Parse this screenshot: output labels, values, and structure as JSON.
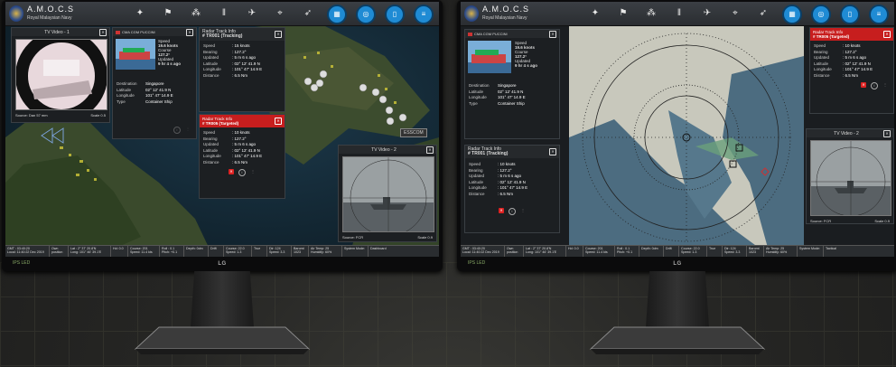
{
  "app": {
    "title": "A.M.O.C.S",
    "subtitle": "Royal Malaysian Navy"
  },
  "toolbar_icons": [
    "compass-icon",
    "flag-icon",
    "network-icon",
    "weapon-icon",
    "plane-icon",
    "map-pin-icon",
    "jet-icon",
    "monitor-icon"
  ],
  "right_buttons": [
    "grid-icon",
    "target-icon",
    "map-icon",
    "layers-icon"
  ],
  "left": {
    "tv1": {
      "title": "TV Video - 1",
      "source": "Source: Dan 57 mm",
      "scale": "Scale 0.5"
    },
    "ship": {
      "name": "CMA CGM PUCCINI",
      "speed_label": "Speed",
      "speed": "19.6 knots",
      "course_label": "Course",
      "course": "127.2°",
      "updated_label": "Updated",
      "updated": "9 hr 4 s ago",
      "rows": [
        [
          "Destination",
          "Singapore"
        ],
        [
          "Latitude",
          "02° 12' 41.9 N"
        ],
        [
          "Longitude",
          "101° 47' 14.9 E"
        ],
        [
          "Type",
          "Container Ship"
        ]
      ]
    },
    "track1": {
      "title": "Radar Track Info",
      "id": "# TR001 (Tracking)",
      "rows": [
        [
          "Speed",
          ": 15 knots"
        ],
        [
          "Bearing",
          ": 127.2°"
        ],
        [
          "Updated",
          ": 5 m 6 s ago"
        ],
        [
          "Latitude",
          ": 02° 12' 41.9 N"
        ],
        [
          "Longitude",
          ": 101° 47' 14.9 E"
        ],
        [
          "Distance",
          ": 6.5 Nm"
        ]
      ]
    },
    "track2": {
      "title": "Radar Track Info",
      "id": "# TR005 (Targeted)",
      "rows": [
        [
          "Speed",
          ": 10 knots"
        ],
        [
          "Bearing",
          ": 127.2°"
        ],
        [
          "Updated",
          ": 5 m 6 s ago"
        ],
        [
          "Latitude",
          ": 02° 12' 41.9 N"
        ],
        [
          "Longitude",
          ": 101° 47' 14.9 E"
        ],
        [
          "Distance",
          ": 6.5 Nm"
        ]
      ]
    },
    "tv2": {
      "title": "TV Video - 2",
      "source": "Source: FCR",
      "scale": "Scale 0.9"
    },
    "escom": "ESSCOM",
    "dashboard": "Dashboard"
  },
  "right": {
    "ship": {
      "name": "CMA CGM PUCCINI",
      "speed_label": "Speed",
      "speed": "19.6 knots",
      "course_label": "Course",
      "course": "127.2°",
      "updated_label": "Updated",
      "updated": "9 hr 4 s ago",
      "rows": [
        [
          "Destination",
          "Singapore"
        ],
        [
          "Latitude",
          "02° 12' 41.9 N"
        ],
        [
          "Longitude",
          "101° 47' 14.9 E"
        ],
        [
          "Type",
          "Container Ship"
        ]
      ]
    },
    "track1": {
      "title": "Radar Track Info",
      "id": "# TR001 (Tracking)",
      "rows": [
        [
          "Speed",
          ": 10 knots"
        ],
        [
          "Bearing",
          ": 127.2°"
        ],
        [
          "Updated",
          ": 5 m 6 s ago"
        ],
        [
          "Latitude",
          ": 02° 12' 41.9 N"
        ],
        [
          "Longitude",
          ": 101° 47' 14.9 E"
        ],
        [
          "Distance",
          ": 6.5 Nm"
        ]
      ]
    },
    "track2": {
      "title": "Radar Track Info",
      "id": "# TR005 (Targeted)",
      "rows": [
        [
          "Speed",
          ": 10 knots"
        ],
        [
          "Bearing",
          ": 127.2°"
        ],
        [
          "Updated",
          ": 5 m 6 s ago"
        ],
        [
          "Latitude",
          ": 02° 12' 41.9 N"
        ],
        [
          "Longitude",
          ": 101° 47' 14.9 E"
        ],
        [
          "Distance",
          ": 6.5 Nm"
        ]
      ]
    },
    "tv2": {
      "title": "TV Video - 2",
      "source": "Source: FCR",
      "scale": "Scale 0.9"
    },
    "tactical": "Tactical"
  },
  "status": [
    "GMT : 03:40:20\nLocal: 11:40:22 Dec 2019",
    "Own\nposition",
    "Lat : 2° 37' 20.8'N\nLong: 101° 46' 39.1'E",
    "Hd: 0.0\n",
    "Course: 201\nSpeed: 11.4 kts",
    "Roll : 0.1\nPitch: +0.1",
    "Depth: 0dm\n",
    "Drift\n",
    "Course: 22.0\nSpeed: 1.3",
    "True\n",
    "Dir: 124\nSpeed: 3.3",
    "Baromt\n1023",
    "Air Temp: 25\nHumidity: 60%",
    "System Mode:"
  ],
  "monitor": {
    "brand": "LG",
    "model": "IPS LED"
  },
  "colors": {
    "accent": "#1f8bd4",
    "alert": "#c71e1e"
  }
}
